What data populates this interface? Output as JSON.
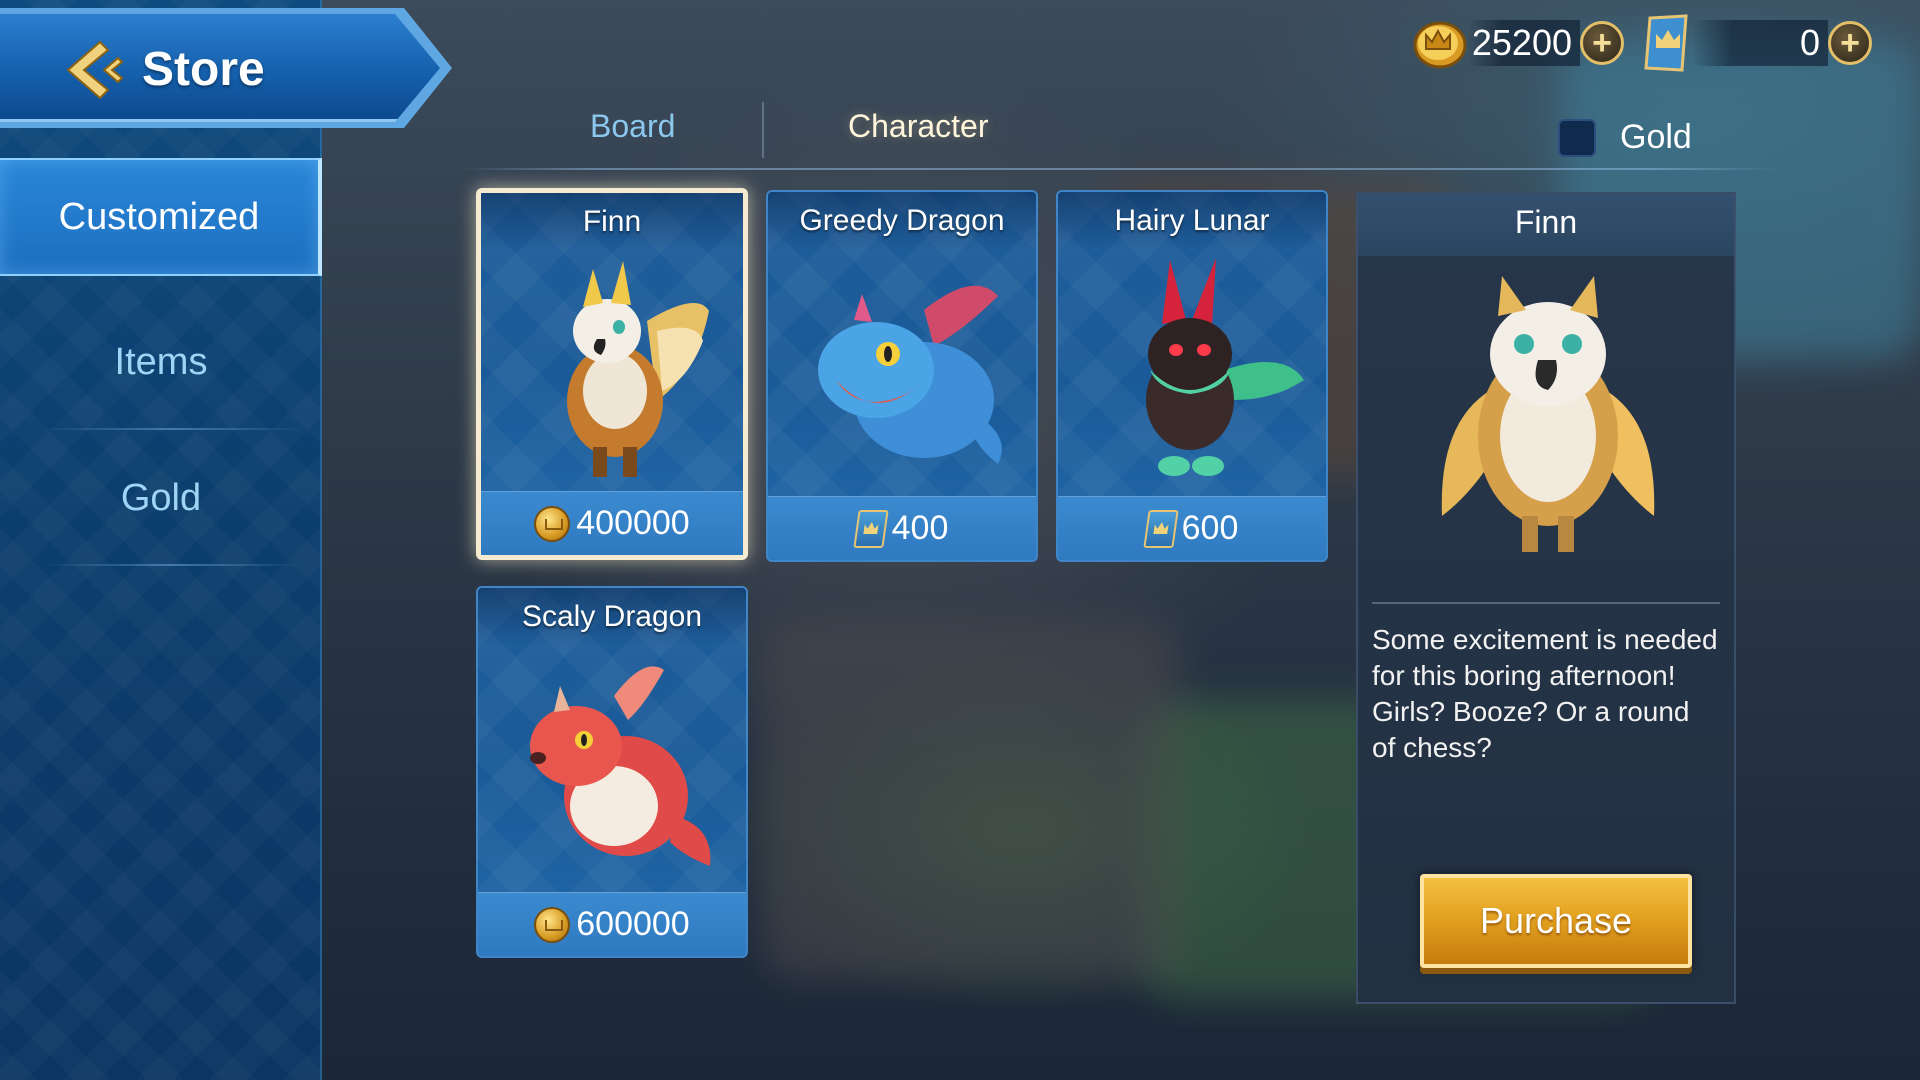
{
  "header": {
    "title": "Store",
    "back_icon": "chevron-left-icon"
  },
  "currency": {
    "gold": {
      "amount": "25200",
      "icon": "crown-coin-icon"
    },
    "tickets": {
      "amount": "0",
      "icon": "crown-ticket-icon"
    },
    "plus_label": "+"
  },
  "sidebar": {
    "items": [
      {
        "label": "Customized",
        "active": true
      },
      {
        "label": "Items",
        "active": false
      },
      {
        "label": "Gold",
        "active": false
      }
    ]
  },
  "tabs": [
    {
      "label": "Board",
      "active": false
    },
    {
      "label": "Character",
      "active": true
    }
  ],
  "filter": {
    "label": "Gold",
    "checked": false
  },
  "cards": [
    {
      "name": "Finn",
      "price": "400000",
      "currency": "gold",
      "selected": true
    },
    {
      "name": "Greedy Dragon",
      "price": "400",
      "currency": "ticket",
      "selected": false
    },
    {
      "name": "Hairy Lunar",
      "price": "600",
      "currency": "ticket",
      "selected": false
    },
    {
      "name": "Scaly Dragon",
      "price": "600000",
      "currency": "gold",
      "selected": false
    }
  ],
  "detail": {
    "title": "Finn",
    "description": "Some excitement is needed for this boring afternoon! Girls? Booze? Or a round of chess?",
    "purchase_label": "Purchase"
  },
  "colors": {
    "accent_blue": "#1d6fc0",
    "gold": "#e3a221",
    "panel": "#223042"
  }
}
